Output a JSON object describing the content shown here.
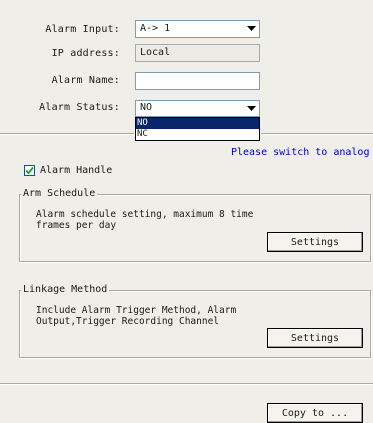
{
  "alarm_input": {
    "label": "Alarm Input:",
    "value": "A-> 1"
  },
  "ip_address": {
    "label": "IP address:",
    "value": "Local"
  },
  "alarm_name": {
    "label": "Alarm Name:",
    "value": ""
  },
  "alarm_status": {
    "label": "Alarm Status:",
    "value": "NO",
    "options": [
      "NO",
      "NC"
    ],
    "highlighted_option": "NO"
  },
  "notice": "Please switch to analog",
  "alarm_handle": {
    "label": "Alarm Handle",
    "checked": true
  },
  "arm_schedule": {
    "title": "Arm Schedule",
    "description": "Alarm schedule setting, maximum 8 time frames per day",
    "button": "Settings"
  },
  "linkage_method": {
    "title": "Linkage Method",
    "description": "Include Alarm Trigger Method, Alarm Output,Trigger Recording Channel",
    "button": "Settings"
  },
  "copy_button": "Copy to ..."
}
